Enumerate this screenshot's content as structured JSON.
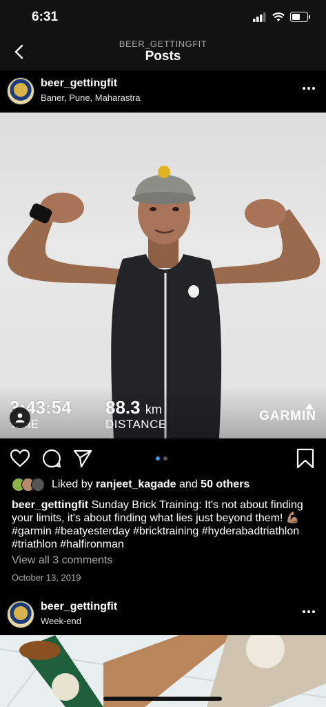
{
  "status": {
    "time": "6:31"
  },
  "nav": {
    "subtitle": "BEER_GETTINGFIT",
    "title": "Posts"
  },
  "post1": {
    "username": "beer_gettingfit",
    "location": "Baner, Pune, Maharastra",
    "stats": {
      "time_value": "3:43:54",
      "time_label": "TIME",
      "distance_value": "88.3",
      "distance_unit": "km",
      "distance_label": "DISTANCE",
      "brand": "GARMIN"
    },
    "likes": {
      "prefix": "Liked by",
      "user": "ranjeet_kagade",
      "conj": "and",
      "others": "50 others"
    },
    "caption": {
      "username": "beer_gettingfit",
      "text": "Sunday Brick Training: It's not about finding your limits, it's about finding what lies just beyond them! 💪🏽 #garmin #beatyesterday #bricktraining #hyderabadtriathlon #triathlon #halfironman"
    },
    "comments_link": "View all 3 comments",
    "date": "October 13, 2019"
  },
  "post2": {
    "username": "beer_gettingfit",
    "location": "Week-end"
  },
  "carousel": {
    "count": 2,
    "active": 1
  },
  "colors": {
    "accent": "#3897f0",
    "background": "#000000",
    "secondary_text": "#a8a8a8"
  }
}
